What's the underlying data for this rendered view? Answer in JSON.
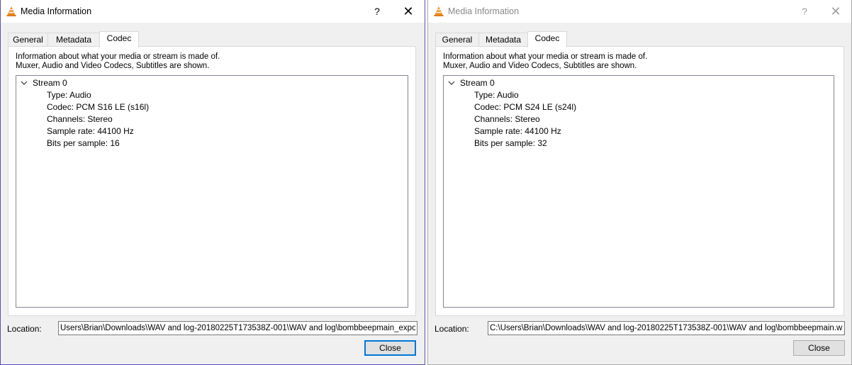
{
  "windows": [
    {
      "title": "Media Information",
      "help_glyph": "?",
      "close_glyph": "✕",
      "tabs": [
        {
          "label": "General"
        },
        {
          "label": "Metadata"
        },
        {
          "label": "Codec"
        }
      ],
      "active_tab": "Codec",
      "info_line1": "Information about what your media or stream is made of.",
      "info_line2": "Muxer, Audio and Video Codecs, Subtitles are shown.",
      "tree": {
        "root": "Stream 0",
        "items": [
          "Type: Audio",
          "Codec: PCM S16 LE (s16l)",
          "Channels: Stereo",
          "Sample rate: 44100 Hz",
          "Bits per sample: 16"
        ]
      },
      "location_label": "Location:",
      "location_value": "Users\\Brian\\Downloads\\WAV and log-20180225T173538Z-001\\WAV and log\\bombbeepmain_export.wav",
      "close_button": "Close"
    },
    {
      "title": "Media Information",
      "help_glyph": "?",
      "close_glyph": "✕",
      "tabs": [
        {
          "label": "General"
        },
        {
          "label": "Metadata"
        },
        {
          "label": "Codec"
        }
      ],
      "active_tab": "Codec",
      "info_line1": "Information about what your media or stream is made of.",
      "info_line2": "Muxer, Audio and Video Codecs, Subtitles are shown.",
      "tree": {
        "root": "Stream 0",
        "items": [
          "Type: Audio",
          "Codec: PCM S24 LE (s24l)",
          "Channels: Stereo",
          "Sample rate: 44100 Hz",
          "Bits per sample: 32"
        ]
      },
      "location_label": "Location:",
      "location_value": "C:\\Users\\Brian\\Downloads\\WAV and log-20180225T173538Z-001\\WAV and log\\bombbeepmain.wav",
      "close_button": "Close"
    }
  ],
  "icons": {
    "app": "vlc-cone-icon",
    "expand": "chevron-down-icon"
  },
  "colors": {
    "active_border": "#0078d7",
    "vlc_orange": "#f28c1c",
    "inactive_title": "#888888"
  }
}
